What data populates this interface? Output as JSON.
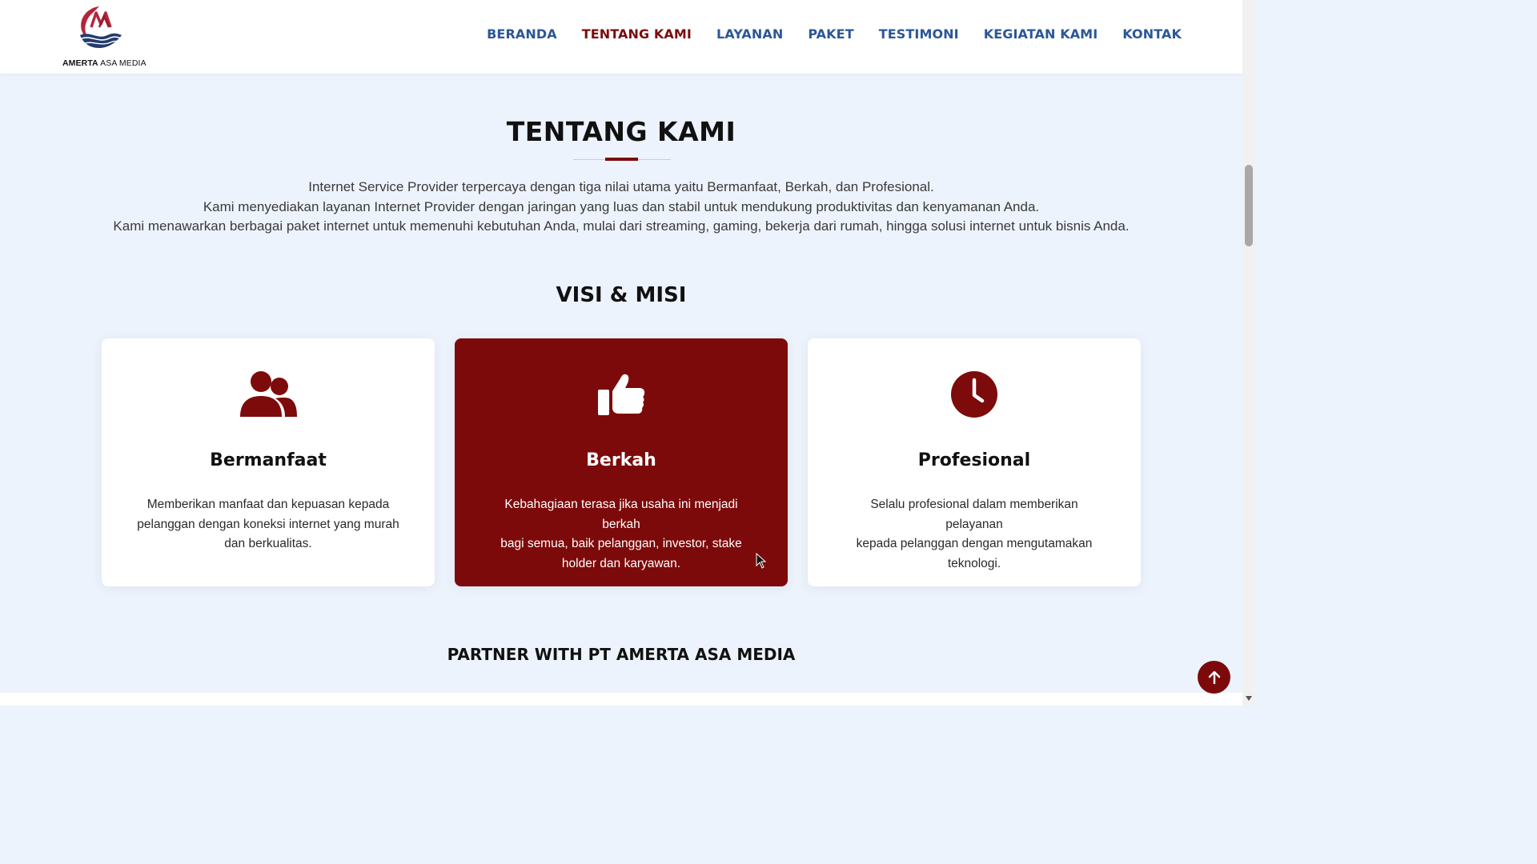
{
  "brand": {
    "name_bold": "AMERTA",
    "name_rest": " ASA MEDIA",
    "colors": {
      "primary_red": "#7d0b0b",
      "nav_blue": "#2b5797",
      "background": "#edf3fc"
    }
  },
  "nav": {
    "items": [
      {
        "label": "BERANDA",
        "active": false
      },
      {
        "label": "TENTANG KAMI",
        "active": true
      },
      {
        "label": "LAYANAN",
        "active": false
      },
      {
        "label": "PAKET",
        "active": false
      },
      {
        "label": "TESTIMONI",
        "active": false
      },
      {
        "label": "KEGIATAN KAMI",
        "active": false
      },
      {
        "label": "KONTAK",
        "active": false
      }
    ]
  },
  "about": {
    "title": "TENTANG KAMI",
    "lines": [
      "Internet Service Provider terpercaya dengan tiga nilai utama yaitu Bermanfaat, Berkah, dan Profesional.",
      "Kami menyediakan layanan Internet Provider dengan jaringan yang luas dan stabil untuk mendukung produktivitas dan kenyamanan Anda.",
      "Kami menawarkan berbagai paket internet untuk memenuhi kebutuhan Anda, mulai dari streaming, gaming, bekerja dari rumah, hingga solusi internet untuk bisnis Anda."
    ]
  },
  "visi_misi": {
    "title": "VISI & MISI",
    "cards": [
      {
        "icon": "users-icon",
        "title": "Bermanfaat",
        "desc_lines": [
          "Memberikan manfaat dan kepuasan kepada",
          "pelanggan dengan koneksi internet yang murah",
          "dan berkualitas."
        ]
      },
      {
        "icon": "thumbs-up-icon",
        "title": "Berkah",
        "desc_lines": [
          "Kebahagiaan terasa jika usaha ini menjadi berkah",
          "bagi semua, baik pelanggan, investor, stake",
          "holder dan karyawan."
        ]
      },
      {
        "icon": "clock-icon",
        "title": "Profesional",
        "desc_lines": [
          "Selalu profesional dalam memberikan pelayanan",
          "kepada pelanggan dengan mengutamakan",
          "teknologi."
        ]
      }
    ]
  },
  "partner": {
    "title": "PARTNER WITH PT AMERTA ASA MEDIA"
  },
  "back_to_top": {
    "icon": "arrow-up-icon"
  }
}
